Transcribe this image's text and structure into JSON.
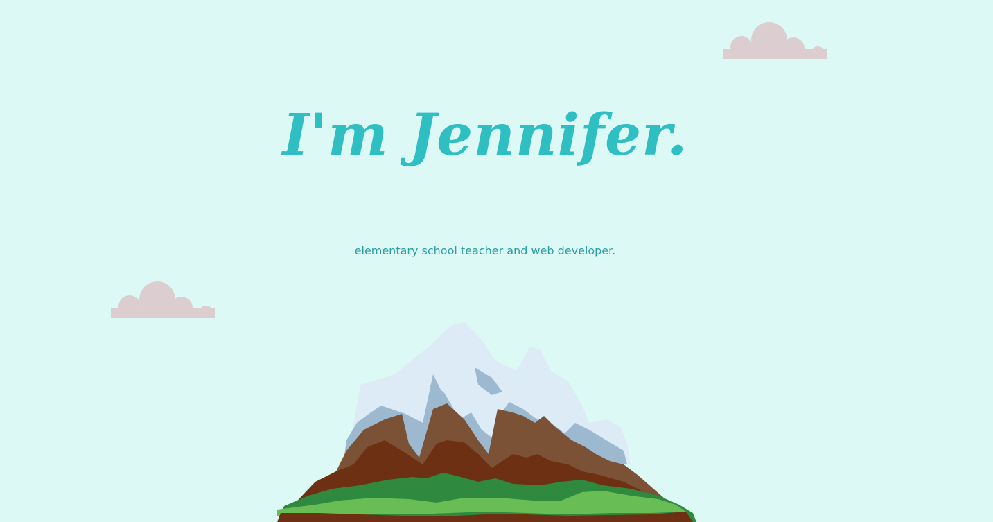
{
  "hero": {
    "title": "I'm Jennifer.",
    "subtitle": "elementary school teacher and web developer."
  },
  "colors": {
    "background": "#ddf9f5",
    "title": "#2fbfc3",
    "subtitle": "#2a9fa6",
    "cloud": "#dccdd1"
  },
  "icons": [
    "cloud-icon",
    "cloud-icon",
    "mountain-illustration"
  ]
}
